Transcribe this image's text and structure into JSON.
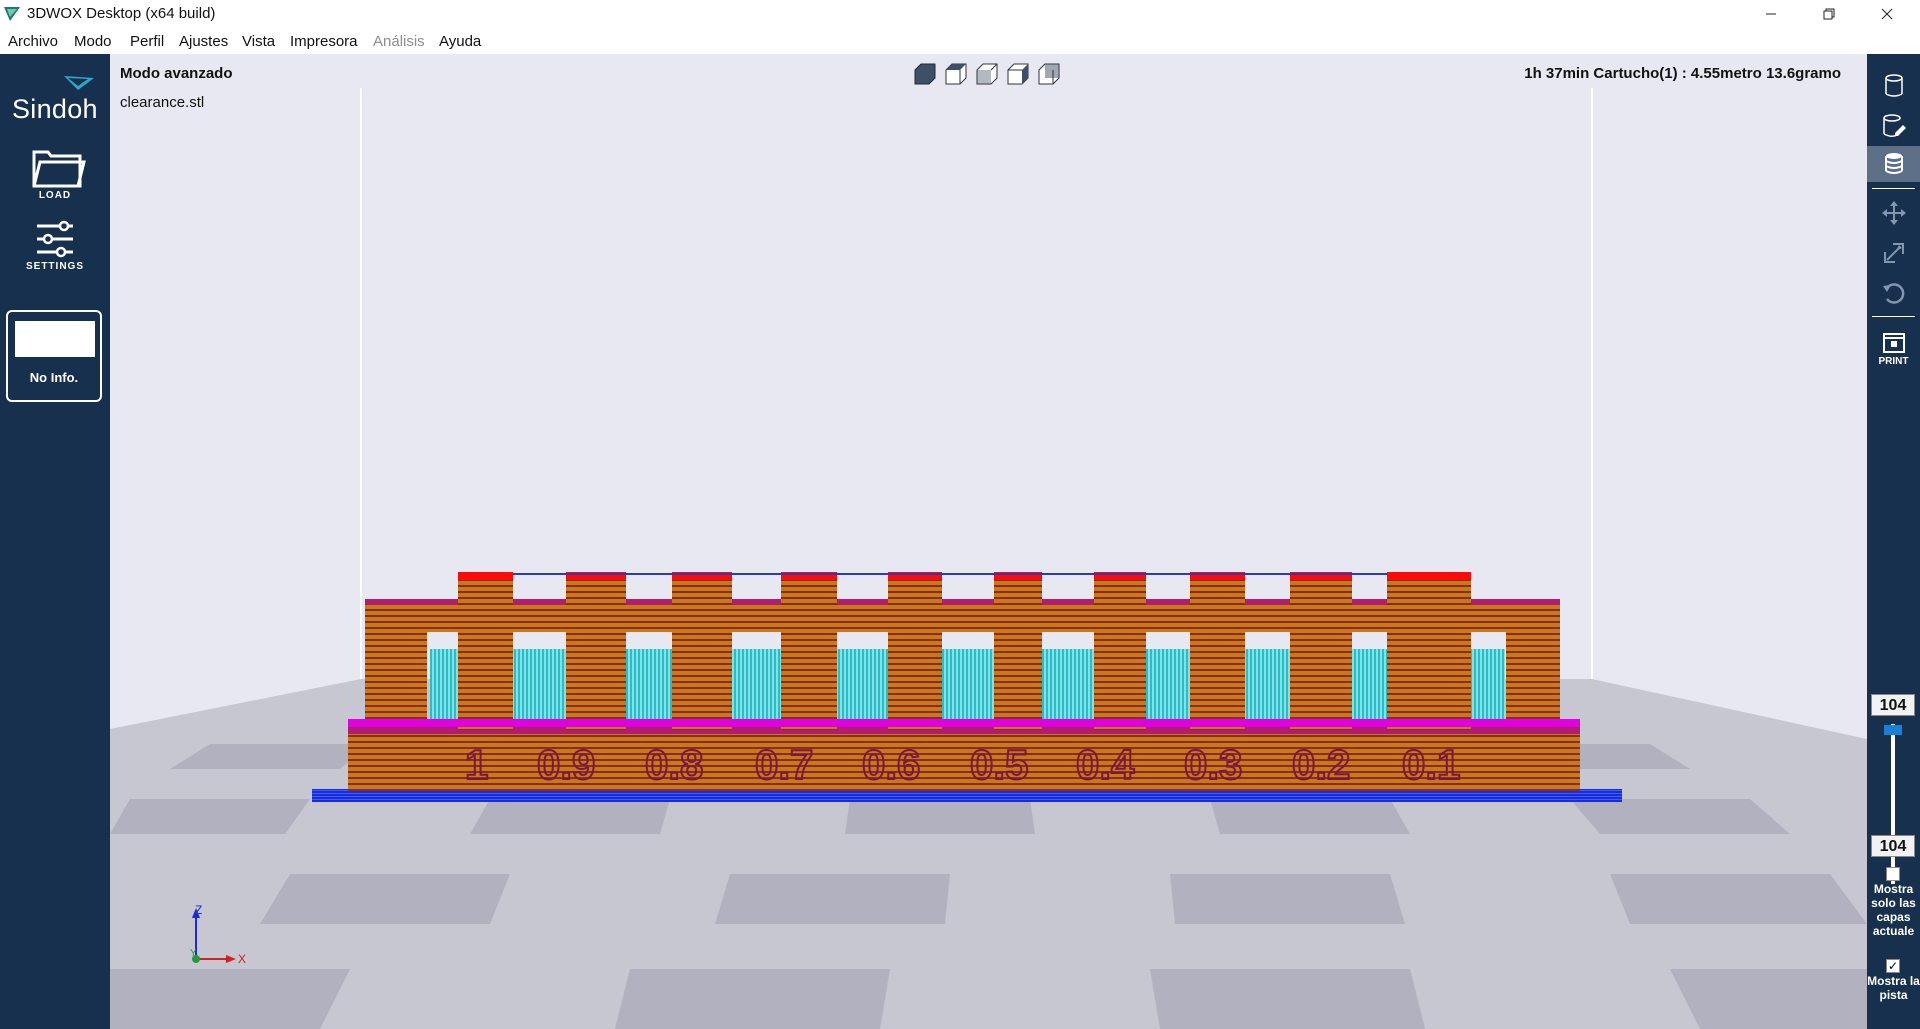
{
  "window": {
    "title": "3DWOX Desktop (x64 build)",
    "controls": {
      "minimize": "minimize-icon",
      "restore": "restore-icon",
      "close": "close-icon"
    }
  },
  "menu": [
    {
      "label": "Archivo",
      "enabled": true
    },
    {
      "label": "Modo",
      "enabled": true
    },
    {
      "label": "Perfil",
      "enabled": true
    },
    {
      "label": "Ajustes",
      "enabled": true
    },
    {
      "label": "Vista",
      "enabled": true
    },
    {
      "label": "Impresora",
      "enabled": true
    },
    {
      "label": "Análisis",
      "enabled": false
    },
    {
      "label": "Ayuda",
      "enabled": true
    }
  ],
  "left_sidebar": {
    "logo": "Sindoh",
    "load_label": "LOAD",
    "settings_label": "SETTINGS",
    "info_text": "No Info."
  },
  "viewport": {
    "mode": "Modo avanzado",
    "file": "clearance.stl",
    "print_info": "1h 37min  Cartucho(1) : 4.55metro 13.6gramo",
    "view_buttons": [
      "view-front-icon",
      "view-top-icon",
      "view-left-icon",
      "view-right-icon",
      "view-iso-icon"
    ],
    "axis": {
      "z": "Z",
      "y": "Y",
      "x": "X"
    },
    "model_labels": [
      "1",
      "0.9",
      "0.8",
      "0.7",
      "0.6",
      "0.5",
      "0.4",
      "0.3",
      "0.2",
      "0.1"
    ]
  },
  "right_sidebar": {
    "tools": [
      "cylinder-view-icon",
      "edit-view-icon",
      "layer-view-icon",
      "move-icon",
      "scale-icon",
      "rotate-icon",
      "print-icon"
    ],
    "print_label": "PRINT",
    "layer_top": "104",
    "layer_bottom": "104",
    "show_current_layers_label": "Mostra solo las capas actuale",
    "show_current_layers_checked": false,
    "show_track_label": "Mostra la pista",
    "show_track_checked": true
  },
  "colors": {
    "sidebar": "#16304d",
    "active_tool": "#5d7088",
    "viewport_bg": "#e8e8f2",
    "wall_outer": "#c97a14",
    "wall_inner": "#a01848",
    "support": "#33c4cc",
    "skin": "#e000e0",
    "top": "#ff0a0a",
    "raft": "#1a2bd8"
  }
}
